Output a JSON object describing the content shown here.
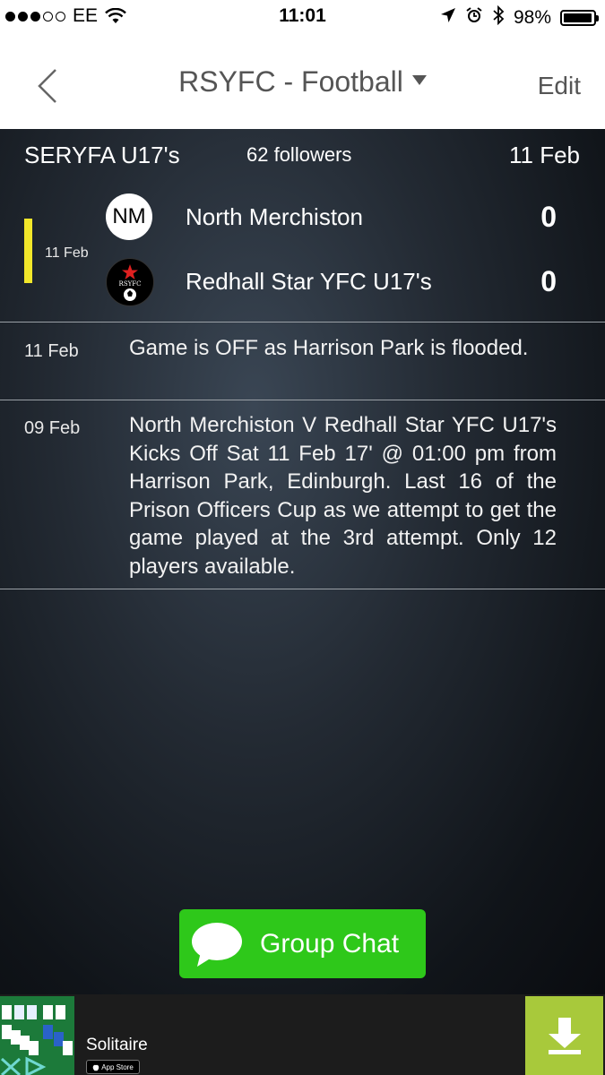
{
  "status_bar": {
    "carrier": "EE",
    "time": "11:01",
    "battery": "98%",
    "battery_level": 0.98,
    "signal_bars_filled": 3,
    "signal_bars_total": 5
  },
  "nav": {
    "title": "RSYFC - Football",
    "edit_label": "Edit"
  },
  "league": {
    "name": "SERYFA U17's",
    "followers": "62 followers",
    "date": "11 Feb"
  },
  "match": {
    "date": "11 Feb",
    "status_color": "#f2e72a",
    "home": {
      "badge": "NM",
      "name": "North Merchiston",
      "score": "0"
    },
    "away": {
      "badge": "RSYFC",
      "name": "Redhall Star YFC U17's",
      "score": "0"
    }
  },
  "updates": [
    {
      "date": "11 Feb",
      "text": "Game is OFF as Harrison Park is flooded."
    },
    {
      "date": "09 Feb",
      "text": "North Merchiston V Redhall Star YFC U17's Kicks Off Sat 11 Feb 17' @ 01:00 pm from Harrison Park, Edinburgh. Last 16 of the Prison Officers Cup as we attempt to get the game played at the 3rd attempt. Only 12 players available."
    }
  ],
  "group_chat": {
    "label": "Group Chat",
    "color": "#2ec81a"
  },
  "ad": {
    "title": "Solitaire",
    "app_store_label": "App Store"
  },
  "colors": {
    "accent_green": "#2ec81a",
    "download_green": "#a8c93b"
  }
}
